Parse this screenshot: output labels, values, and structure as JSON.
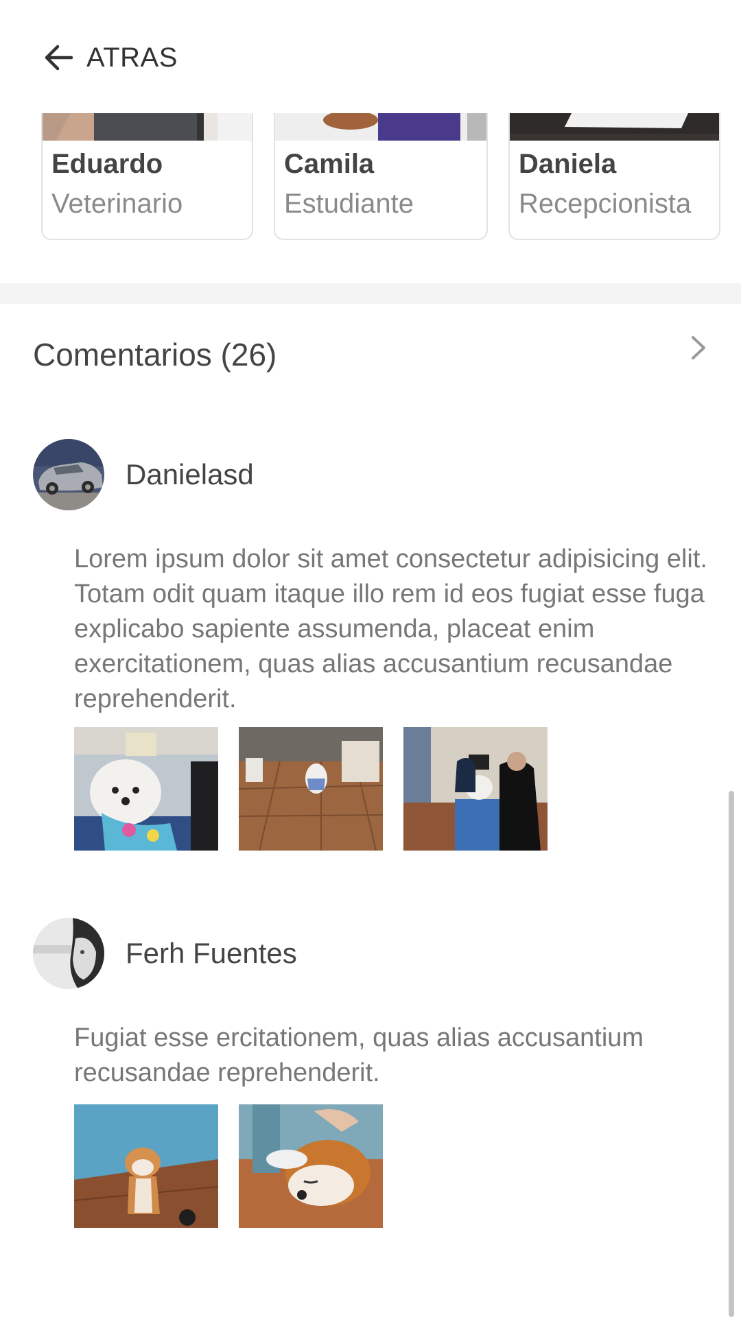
{
  "header": {
    "back_label": "ATRAS"
  },
  "staff": [
    {
      "name": "Eduardo",
      "role": "Veterinario"
    },
    {
      "name": "Camila",
      "role": "Estudiante"
    },
    {
      "name": "Daniela",
      "role": "Recepcionista"
    }
  ],
  "comments_section": {
    "title": "Comentarios (26)"
  },
  "comments": [
    {
      "author": "Danielasd",
      "text": "Lorem ipsum dolor sit amet consectetur adipisicing elit. Totam odit quam itaque illo rem id eos fugiat esse fuga explicabo sapiente assumenda, placeat enim exercitationem, quas alias accusantium recusandae reprehenderit.",
      "photo_count": 3
    },
    {
      "author": "Ferh Fuentes",
      "text": "Fugiat esse ercitationem, quas alias accusantium recusandae reprehenderit.",
      "photo_count": 2
    }
  ]
}
